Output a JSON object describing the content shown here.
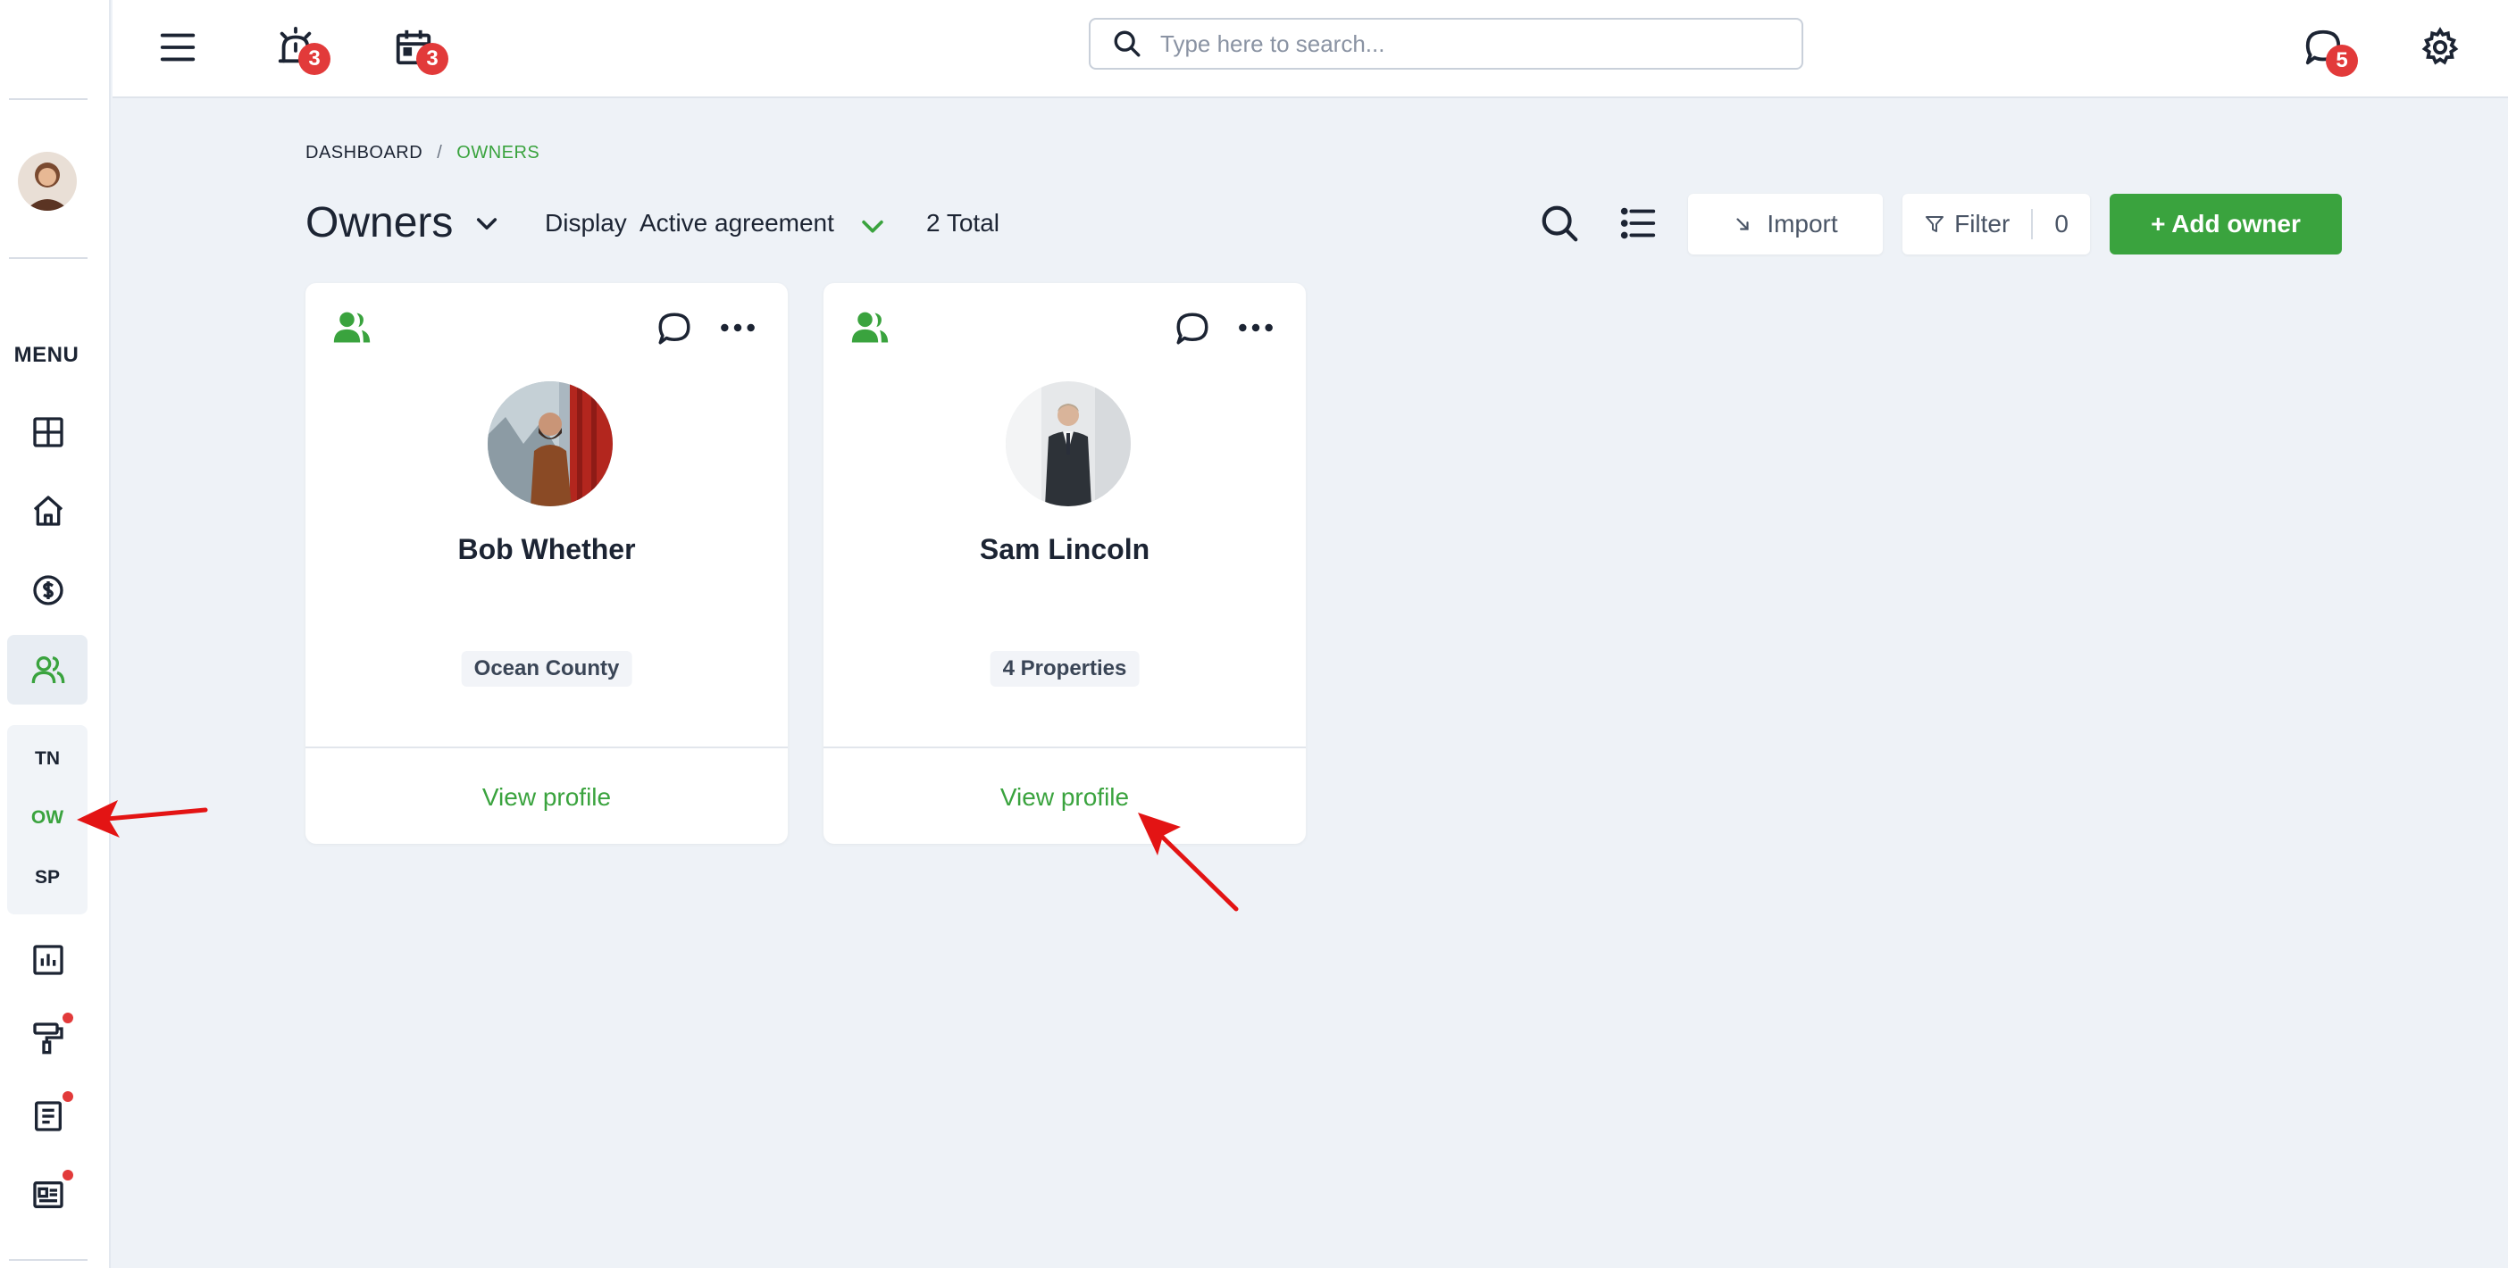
{
  "search": {
    "placeholder": "Type here to search..."
  },
  "topbar": {
    "alarm_badge": "3",
    "calendar_badge": "3",
    "chat_badge": "5"
  },
  "sidebar": {
    "menu_label": "MENU",
    "sub_items": [
      "TN",
      "OW",
      "SP"
    ]
  },
  "breadcrumb": {
    "root": "DASHBOARD",
    "separator": "/",
    "current": "OWNERS"
  },
  "header": {
    "title": "Owners",
    "display_label": "Display",
    "display_value": "Active agreement",
    "total": "2 Total"
  },
  "toolbar": {
    "import_label": "Import",
    "filter_label": "Filter",
    "filter_count": "0",
    "add_label": "+ Add owner"
  },
  "cards": [
    {
      "name": "Bob Whether",
      "tag": "Ocean County",
      "view_label": "View profile"
    },
    {
      "name": "Sam Lincoln",
      "tag": "4 Properties",
      "view_label": "View profile"
    }
  ],
  "colors": {
    "accent": "#3aa33e",
    "badge": "#e23a3a",
    "annotation": "#e31414"
  }
}
